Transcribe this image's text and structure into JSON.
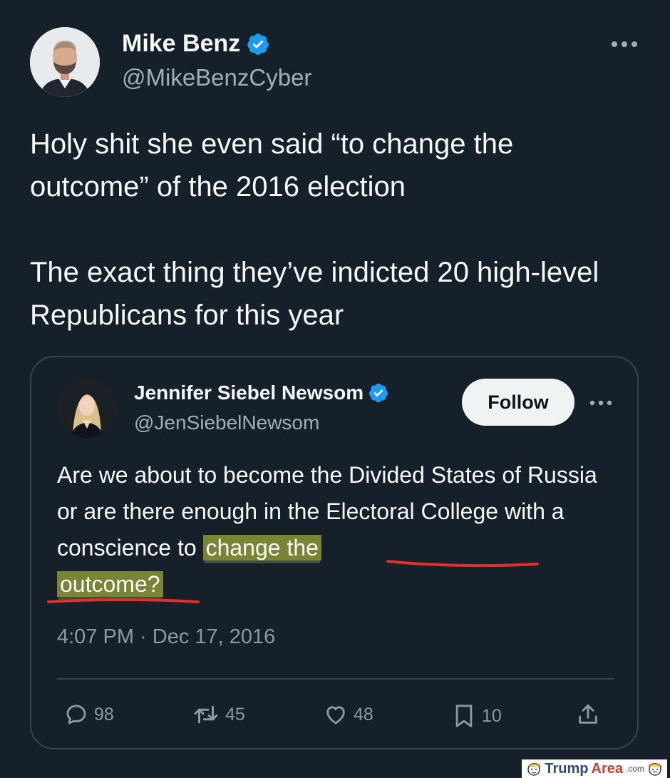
{
  "tweet": {
    "author_name": "Mike Benz",
    "author_handle": "@MikeBenzCyber",
    "text": "Holy shit she even said “to change the outcome” of the 2016 election\n\nThe exact thing they’ve indicted 20 high-level Republicans for this year"
  },
  "quoted_tweet": {
    "author_name": "Jennifer Siebel Newsom",
    "author_handle": "@JenSiebelNewsom",
    "follow_label": "Follow",
    "text_plain": "Are we about to become the Divided States of Russia or are there enough in the Electoral College with a conscience to",
    "text_highlight_1": "change the",
    "text_highlight_2": "outcome?",
    "timestamp": "4:07 PM · Dec 17, 2016",
    "actions": {
      "replies": "98",
      "reposts": "45",
      "likes": "48",
      "bookmarks": "10"
    }
  },
  "watermark": {
    "part1": "Trump",
    "part2": "Area",
    "part3": ".com"
  },
  "colors": {
    "background": "#15202b",
    "verified": "#1d9bf0",
    "highlight": "#cdd73c",
    "underline": "#e0302a"
  },
  "icons": {
    "more": "more-horizontal-icon",
    "verified": "verified-badge-icon",
    "reply": "reply-bubble-icon",
    "repost": "repost-arrows-icon",
    "like": "heart-icon",
    "bookmark": "bookmark-icon",
    "share": "share-upload-icon"
  }
}
